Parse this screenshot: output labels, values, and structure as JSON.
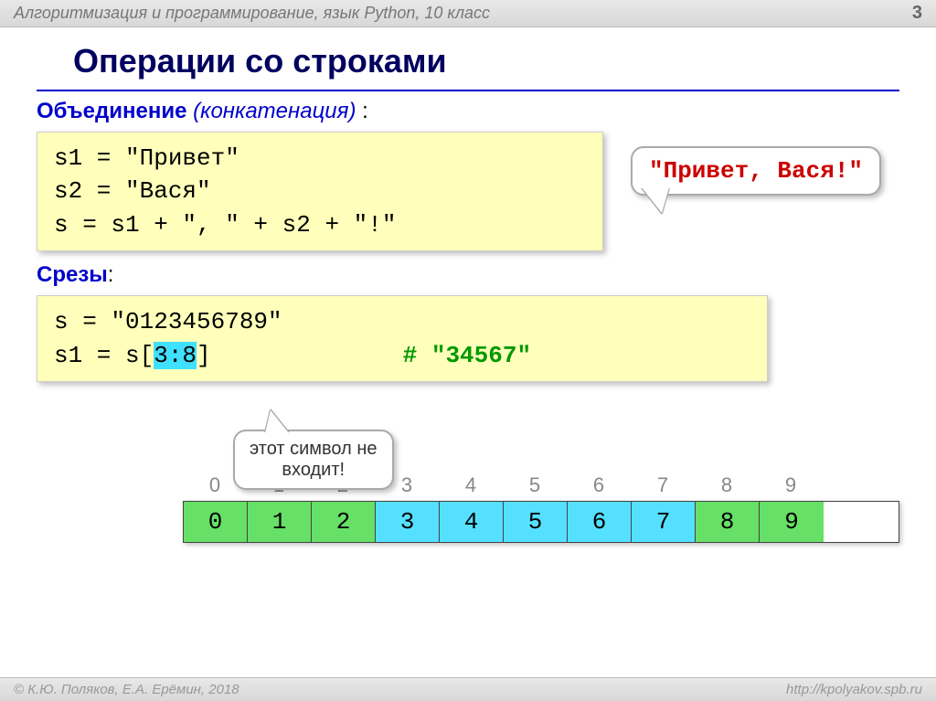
{
  "header_title": "Алгоритмизация и программирование, язык Python, 10 класс",
  "page_number": "3",
  "main_title": "Операции со строками",
  "section1": {
    "label": "Объединение",
    "italic": "(конкатенация)",
    "colon": " :",
    "code": {
      "l1": "s1 = \"Привет\"",
      "l2": "s2 = \"Вася\"",
      "l3": "s  = s1 + \", \" + s2 + \"!\""
    },
    "result": "\"Привет, Вася!\""
  },
  "section2": {
    "label": "Срезы",
    "colon": ":",
    "code": {
      "l1": "s = \"0123456789\"",
      "l2a": "s1 = s[",
      "l2b": "3:8",
      "l2c": "]",
      "comment": "# \"34567\""
    },
    "note_l1": "этот символ не",
    "note_l2": "входит!"
  },
  "table": {
    "indices": [
      "0",
      "1",
      "2",
      "3",
      "4",
      "5",
      "6",
      "7",
      "8",
      "9"
    ],
    "values": [
      "0",
      "1",
      "2",
      "3",
      "4",
      "5",
      "6",
      "7",
      "8",
      "9"
    ],
    "highlight_start": 3,
    "highlight_end": 7
  },
  "footer": {
    "left": "© К.Ю. Поляков, Е.А. Ерёмин, 2018",
    "right": "http://kpolyakov.spb.ru"
  }
}
